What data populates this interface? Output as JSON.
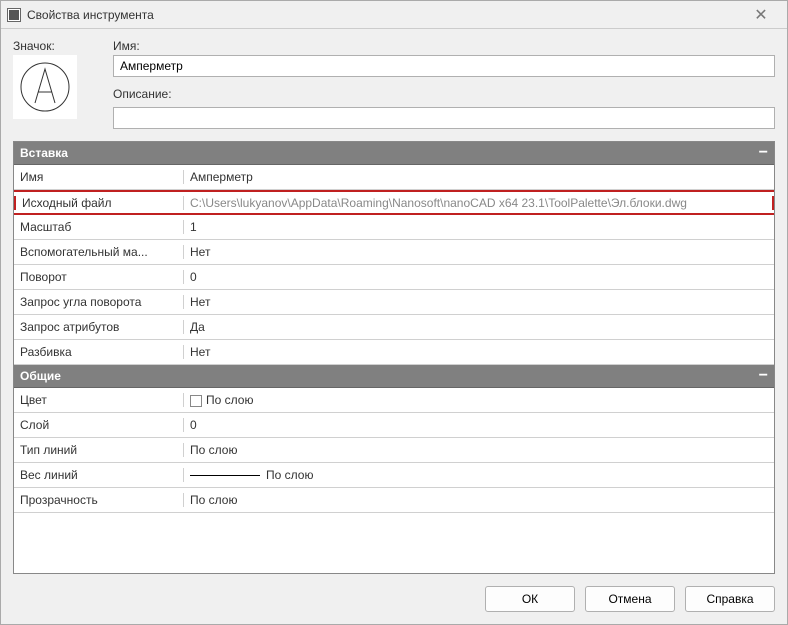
{
  "window": {
    "title": "Свойства инструмента"
  },
  "top": {
    "icon_label": "Значок:",
    "name_label": "Имя:",
    "name_value": "Амперметр",
    "desc_label": "Описание:",
    "desc_value": ""
  },
  "sections": {
    "insert": {
      "title": "Вставка",
      "rows": {
        "name": {
          "key": "Имя",
          "val": "Амперметр"
        },
        "sourcefile": {
          "key": "Исходный файл",
          "val": "C:\\Users\\lukyanov\\AppData\\Roaming\\Nanosoft\\nanoCAD x64 23.1\\ToolPalette\\Эл.блоки.dwg"
        },
        "scale": {
          "key": "Масштаб",
          "val": "1"
        },
        "auxscale": {
          "key": "Вспомогательный ма...",
          "val": "Нет"
        },
        "rotation": {
          "key": "Поворот",
          "val": "0"
        },
        "promptrot": {
          "key": "Запрос угла поворота",
          "val": "Нет"
        },
        "promptattr": {
          "key": "Запрос атрибутов",
          "val": "Да"
        },
        "explode": {
          "key": "Разбивка",
          "val": "Нет"
        }
      }
    },
    "general": {
      "title": "Общие",
      "rows": {
        "color": {
          "key": "Цвет",
          "val": "По слою"
        },
        "layer": {
          "key": "Слой",
          "val": "0"
        },
        "linetype": {
          "key": "Тип линий",
          "val": "По слою"
        },
        "lineweight": {
          "key": "Вес линий",
          "val": "По слою"
        },
        "transparency": {
          "key": "Прозрачность",
          "val": "По слою"
        }
      }
    }
  },
  "buttons": {
    "ok": "ОК",
    "cancel": "Отмена",
    "help": "Справка"
  }
}
